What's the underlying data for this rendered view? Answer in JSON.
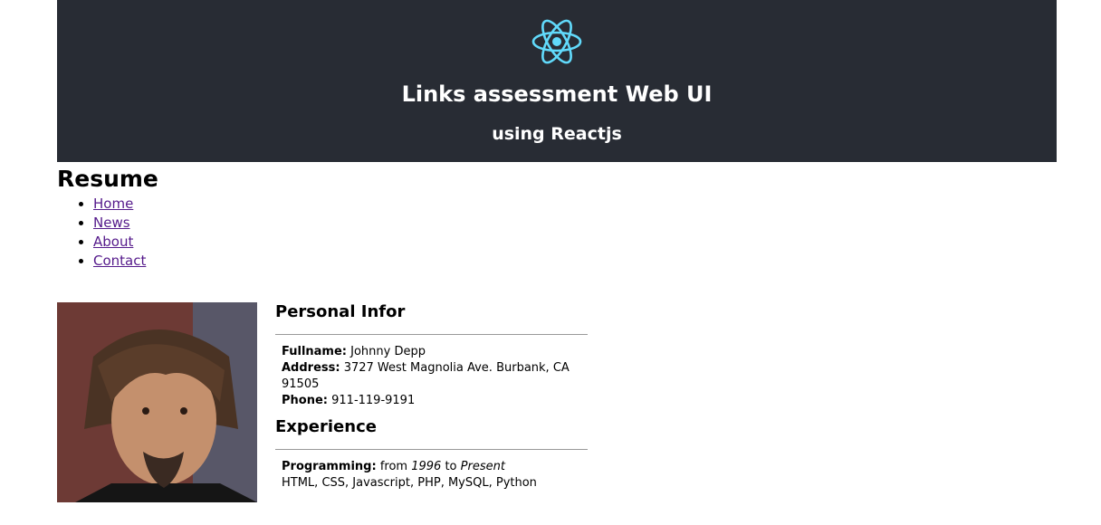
{
  "header": {
    "logo_icon": "react-atom-icon",
    "title": "Links assessment Web UI",
    "subtitle": "using Reactjs",
    "background_color": "#282c34",
    "logo_color": "#61dafb"
  },
  "resume": {
    "title": "Resume"
  },
  "nav": {
    "items": [
      {
        "label": "Home"
      },
      {
        "label": "News"
      },
      {
        "label": "About"
      },
      {
        "label": "Contact"
      }
    ]
  },
  "personal": {
    "section_title": "Personal Infor",
    "fullname_label": "Fullname:",
    "fullname_value": "Johnny Depp",
    "address_label": "Address:",
    "address_value": "3727 West Magnolia Ave. Burbank, CA 91505",
    "phone_label": "Phone:",
    "phone_value": "911-119-9191"
  },
  "experience": {
    "section_title": "Experience",
    "programming_label": "Programming:",
    "from_word": "from",
    "start_year": "1996",
    "to_word": "to",
    "end_label": "Present",
    "skills": "HTML, CSS, Javascript, PHP, MySQL, Python"
  }
}
